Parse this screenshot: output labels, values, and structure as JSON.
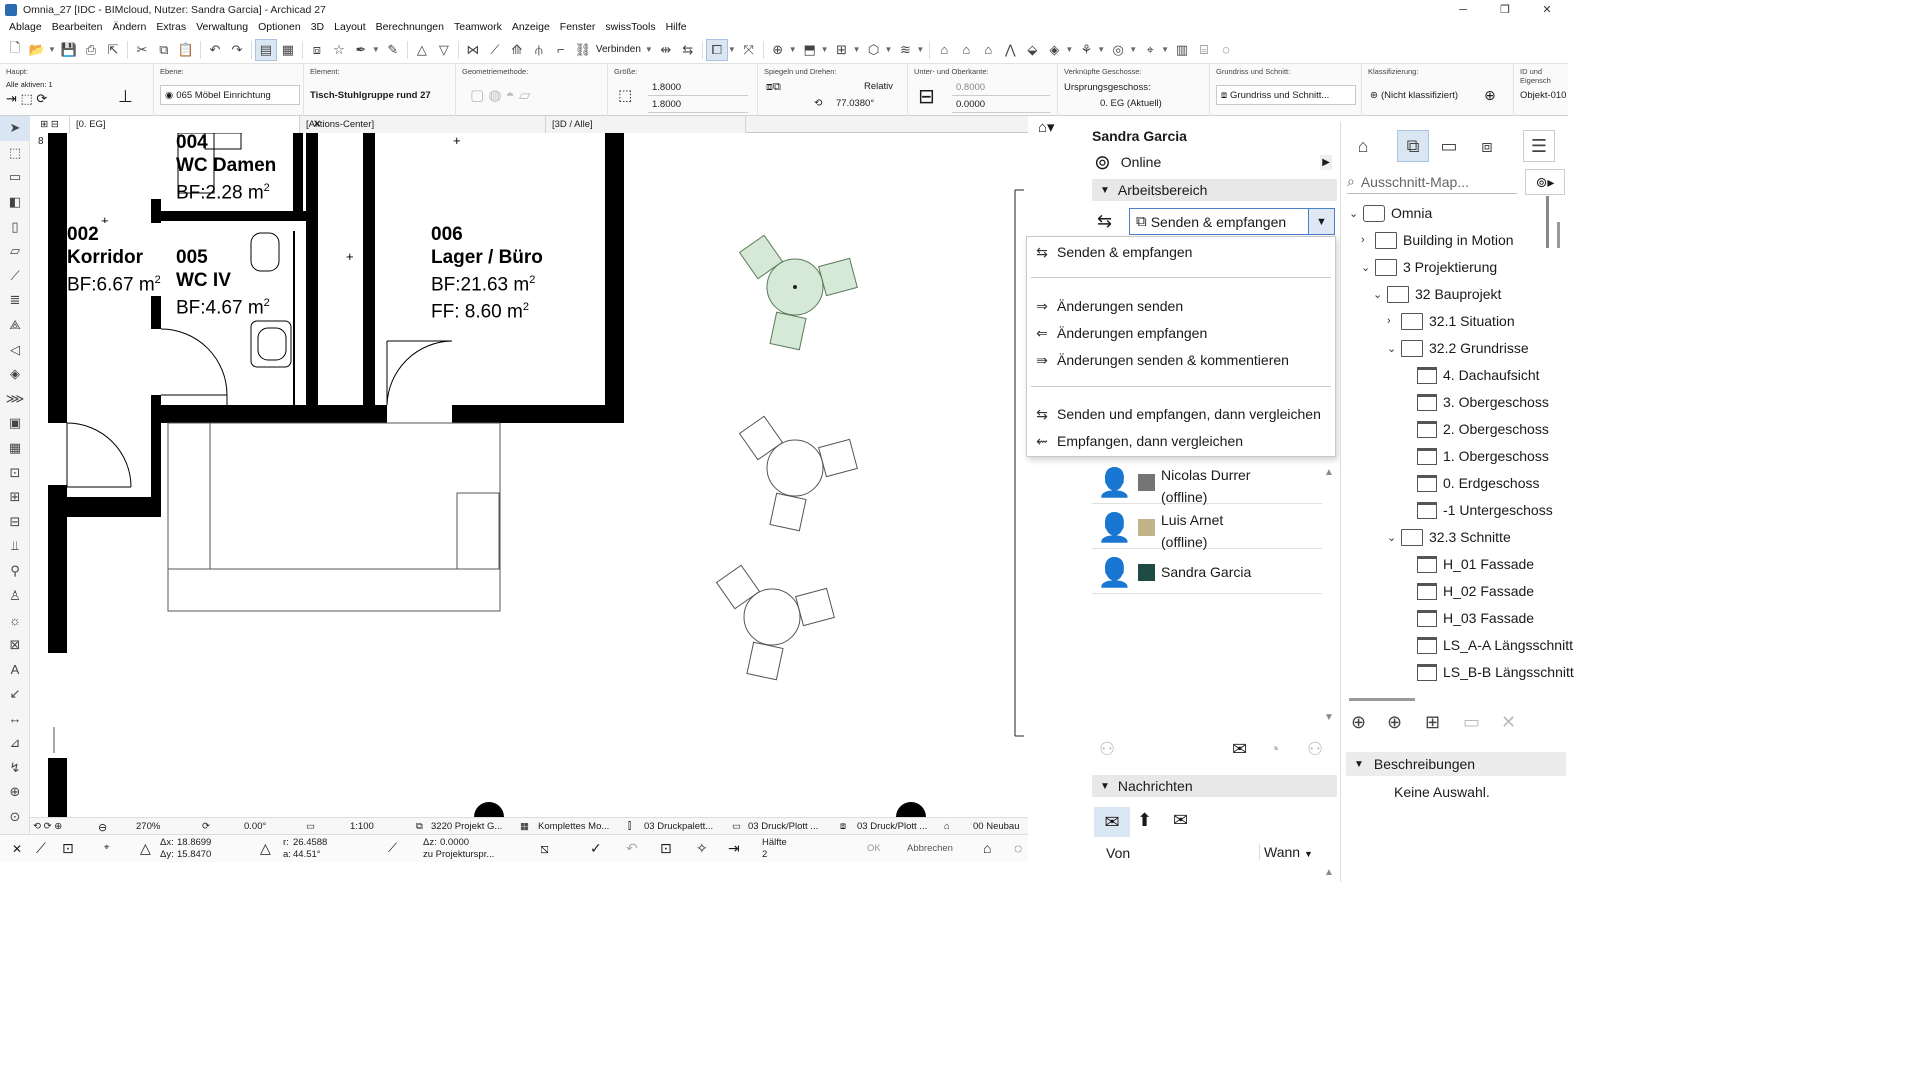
{
  "window": {
    "title": "Omnia_27 [IDC - BIMcloud, Nutzer: Sandra Garcia] - Archicad 27"
  },
  "menu": [
    "Ablage",
    "Bearbeiten",
    "Ändern",
    "Extras",
    "Verwaltung",
    "Optionen",
    "3D",
    "Layout",
    "Berechnungen",
    "Teamwork",
    "Anzeige",
    "Fenster",
    "swissTools",
    "Hilfe"
  ],
  "toolbar": {
    "connect_label": "Verbinden"
  },
  "infobox": {
    "haupt_label": "Haupt:",
    "alle_aktiven": "Alle aktiven: 1",
    "ebene_label": "Ebene:",
    "ebene_value": "065 Möbel Einrichtung",
    "element_label": "Element:",
    "element_value": "Tisch-Stuhlgruppe rund 27",
    "geometrie_label": "Geometriemethode:",
    "groesse_label": "Größe:",
    "groesse_a": "1.8000",
    "groesse_b": "1.8000",
    "spiegeln_label": "Spiegeln und Drehen:",
    "relativ": "Relativ",
    "angle": "77.0380°",
    "unterober_label": "Unter- und Oberkante:",
    "unter_value": "0.8000",
    "ober_value": "0.0000",
    "verknuepft_label": "Verknüpfte Geschosse:",
    "ursprung_label": "Ursprungsgeschoss:",
    "ursprung_value": "0. EG (Aktuell)",
    "grundriss_label": "Grundriss und Schnitt:",
    "grundriss_value": "Grundriss und Schnitt...",
    "klass_label": "Klassifizierung:",
    "klass_value": "(Nicht klassifiziert)",
    "id_label": "ID und Eigensch",
    "id_value": "Objekt-010"
  },
  "tabs": {
    "plan": "[0. EG]",
    "action": "[Aktions-Center]",
    "view3d": "[3D / Alle]"
  },
  "plan": {
    "r004_num": "004",
    "r004_name": "WC Damen",
    "r004_area": "BF:2.28 m",
    "r002_num": "002",
    "r002_name": "Korridor",
    "r002_area": "BF:6.67 m",
    "r005_num": "005",
    "r005_name": "WC IV",
    "r005_area": "BF:4.67 m",
    "r006_num": "006",
    "r006_name": "Lager / Büro",
    "r006_area": "BF:21.63 m",
    "r006_ff": "FF:  8.60 m",
    "sq": "2",
    "dim": "8"
  },
  "statusbar": {
    "zoom": "270%",
    "angle": "0.00°",
    "scale": "1:100",
    "model": "3220 Projekt G...",
    "komplett": "Komplettes Mo...",
    "druck1": "03 Druckpalett...",
    "druck2": "03 Druck/Plott ...",
    "druck3": "03 Druck/Plott ...",
    "neubau": "00 Neubau"
  },
  "coords": {
    "dx": "18.8699",
    "dy": "15.8470",
    "dz": "0.0000",
    "r": "26.4588",
    "a": "44.51°",
    "ref": "zu Projekturspr...",
    "haelfte": "Hälfte",
    "haelfte_n": "2",
    "ok": "OK",
    "cancel": "Abbrechen"
  },
  "teamwork": {
    "user": "Sandra Garcia",
    "status": "Online",
    "workspace": "Arbeitsbereich",
    "combo": "Senden & empfangen",
    "members": [
      {
        "name": "Nicolas Durrer",
        "state": "(offline)",
        "color": "#757575"
      },
      {
        "name": "Luis Arnet",
        "state": "(offline)",
        "color": "#c2b48a"
      },
      {
        "name": "Sandra Garcia",
        "state": "",
        "color": "#1f4b44"
      }
    ],
    "messages": "Nachrichten",
    "col_from": "Von",
    "col_when": "Wann"
  },
  "dropdown": {
    "items": [
      "Senden & empfangen",
      "Änderungen senden",
      "Änderungen empfangen",
      "Änderungen senden & kommentieren",
      "Senden und empfangen, dann vergleichen",
      "Empfangen, dann vergleichen"
    ]
  },
  "navigator": {
    "search_placeholder": "Ausschnitt-Map...",
    "tree": [
      "Omnia",
      "Building in Motion",
      "3 Projektierung",
      "32 Bauprojekt",
      "32.1 Situation",
      "32.2 Grundrisse",
      "4. Dachaufsicht",
      "3. Obergeschoss",
      "2. Obergeschoss",
      "1. Obergeschoss",
      "0. Erdgeschoss",
      "-1 Untergeschoss",
      "32.3 Schnitte",
      "H_01 Fassade",
      "H_02 Fassade",
      "H_03 Fassade",
      "LS_A-A Längsschnitt",
      "LS_B-B Längsschnitt"
    ],
    "beschreibungen": "Beschreibungen",
    "keine_auswahl": "Keine Auswahl."
  }
}
